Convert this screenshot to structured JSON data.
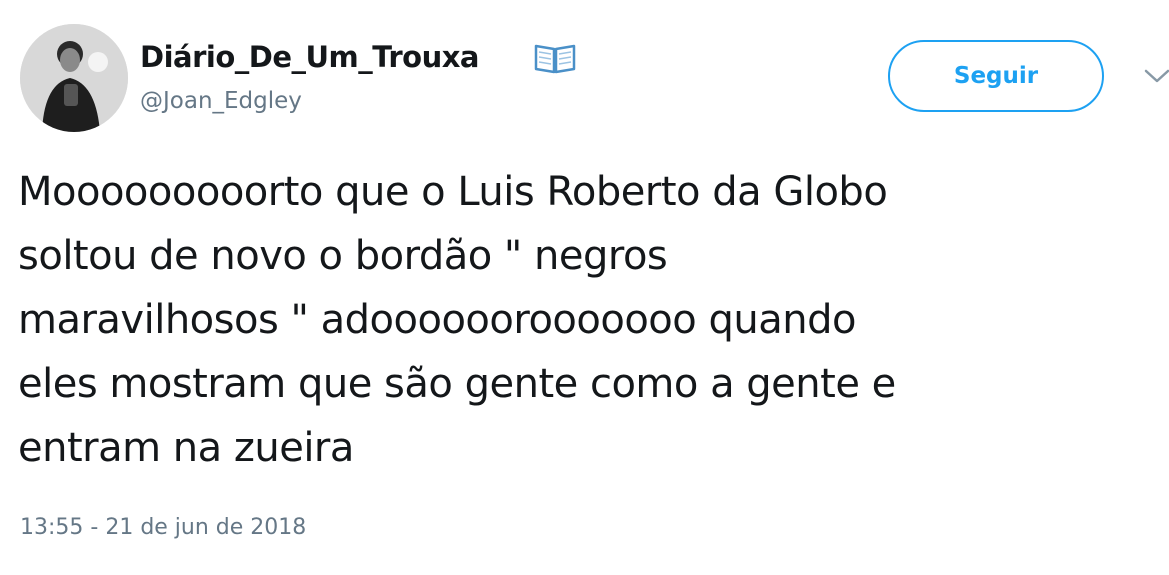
{
  "author": {
    "display_name": "Diário_De_Um_Trouxa",
    "name_emoji": "open-book-icon",
    "handle": "@Joan_Edgley",
    "avatar": "profile-avatar"
  },
  "actions": {
    "follow_label": "Seguir",
    "more_icon": "chevron-down-icon"
  },
  "tweet": {
    "lines": [
      "Mooooooooorto que o Luis Roberto da Globo",
      "soltou de novo o bordão \" negros",
      "maravilhosos \" adoooooorooooooo quando",
      "eles mostram que são gente como a gente e",
      "entram na zueira"
    ],
    "timestamp": "13:55 - 21 de jun de 2018"
  },
  "colors": {
    "accent": "#1da1f2",
    "secondary_text": "#657786",
    "primary_text": "#14171a"
  }
}
